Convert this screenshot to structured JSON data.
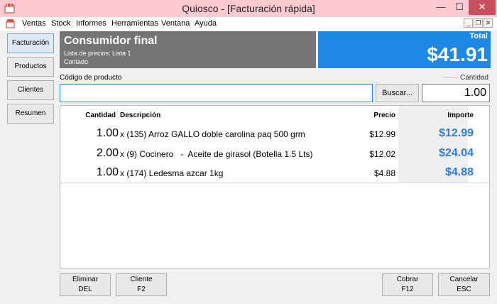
{
  "window": {
    "title": "Quiosco - [Facturación rápida]",
    "minimize_glyph": "—",
    "maximize_glyph": "☐",
    "close_glyph": "✕"
  },
  "menu": {
    "items": [
      "Ventas",
      "Stock",
      "Informes",
      "Herramientas",
      "Ventana",
      "Ayuda"
    ],
    "mdi_minimize": "_",
    "mdi_restore": "❐",
    "mdi_close": "✕"
  },
  "sidebar": {
    "items": [
      "Facturación",
      "Productos",
      "Clientes",
      "Resumen"
    ],
    "active_index": 0
  },
  "customer": {
    "name": "Consumidor final",
    "price_list": "Lista de precios: Lista 1",
    "payment": "Contado"
  },
  "total": {
    "label": "Total",
    "value": "$41.91"
  },
  "entry": {
    "code_label": "Código de producto",
    "code_value": "",
    "search_label": "Buscar...",
    "qty_label": "Cantidad",
    "qty_value": "1.00"
  },
  "grid": {
    "headers": {
      "qty": "Cantidad",
      "desc": "Descripción",
      "price": "Precio",
      "total": "Importe"
    },
    "rows": [
      {
        "qty": "1.00",
        "desc": "x (135) Arroz GALLO doble carolina paq 500 grm",
        "price": "$12.99",
        "total": "$12.99"
      },
      {
        "qty": "2.00",
        "desc": "x (9) Cocinero   -  Aceite de girasol (Botella 1.5 Lts)",
        "price": "$12.02",
        "total": "$24.04"
      },
      {
        "qty": "1.00",
        "desc": "x (174) Ledesma azcar 1kg",
        "price": "$4.88",
        "total": "$4.88"
      }
    ]
  },
  "footer": {
    "delete": {
      "label": "Eliminar",
      "key": "DEL"
    },
    "client": {
      "label": "Cliente",
      "key": "F2"
    },
    "charge": {
      "label": "Cobrar",
      "key": "F12"
    },
    "cancel": {
      "label": "Cancelar",
      "key": "ESC"
    }
  },
  "colors": {
    "titlebar": "#ffcad0",
    "customer_panel": "#757575",
    "total_panel": "#1e88e8",
    "amount_text": "#2b7ede",
    "close_button": "#c7505c"
  }
}
